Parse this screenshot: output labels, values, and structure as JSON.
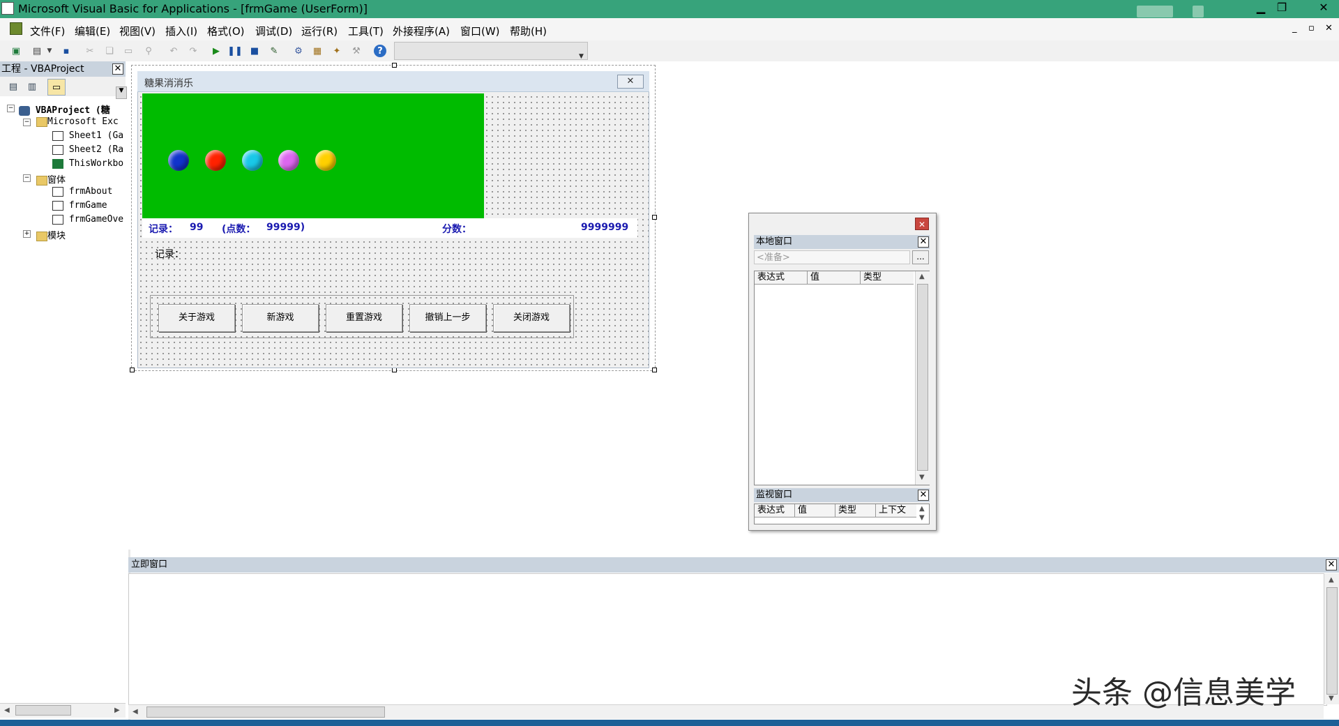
{
  "window": {
    "title": "Microsoft Visual Basic for Applications - [frmGame (UserForm)]"
  },
  "menu": [
    "文件(F)",
    "编辑(E)",
    "视图(V)",
    "插入(I)",
    "格式(O)",
    "调试(D)",
    "运行(R)",
    "工具(T)",
    "外接程序(A)",
    "窗口(W)",
    "帮助(H)"
  ],
  "project": {
    "title": "工程 - VBAProject",
    "root": "VBAProject (糖",
    "excel_folder": "Microsoft Exc",
    "sheets": [
      "Sheet1 (Ga",
      "Sheet2 (Ra",
      "ThisWorkbo"
    ],
    "forms_folder": "窗体",
    "forms": [
      "frmAbout",
      "frmGame",
      "frmGameOve"
    ],
    "modules_folder": "模块"
  },
  "userform": {
    "caption": "糖果消消乐",
    "close_glyph": "✕",
    "balls": [
      {
        "name": "blue-ball",
        "color": "#1133cc"
      },
      {
        "name": "red-ball",
        "color": "#ff2200"
      },
      {
        "name": "cyan-ball",
        "color": "#19c8e8"
      },
      {
        "name": "violet-ball",
        "color": "#dd66ee"
      },
      {
        "name": "yellow-ball",
        "color": "#ffd000"
      }
    ],
    "record_label": "记录：",
    "record_value": "99",
    "points_label": "(点数：",
    "points_value": "99999)",
    "score_label": "分数：",
    "score_value": "9999999",
    "record_area_label": "记录：",
    "buttons": [
      "关于游戏",
      "新游戏",
      "重置游戏",
      "撤销上一步",
      "关闭游戏"
    ]
  },
  "locals": {
    "title": "本地窗口",
    "status": "<准备>",
    "ellipsis": "...",
    "headers": [
      "表达式",
      "值",
      "类型"
    ]
  },
  "watch": {
    "title": "监视窗口",
    "headers": [
      "表达式",
      "值",
      "类型",
      "上下文"
    ]
  },
  "immediate": {
    "title": "立即窗口"
  },
  "watermark": "头条 @信息美学",
  "colors": {
    "titlebar": "#37a37b",
    "form_canvas": "#00bb00",
    "score_text": "#1a1ab0"
  }
}
